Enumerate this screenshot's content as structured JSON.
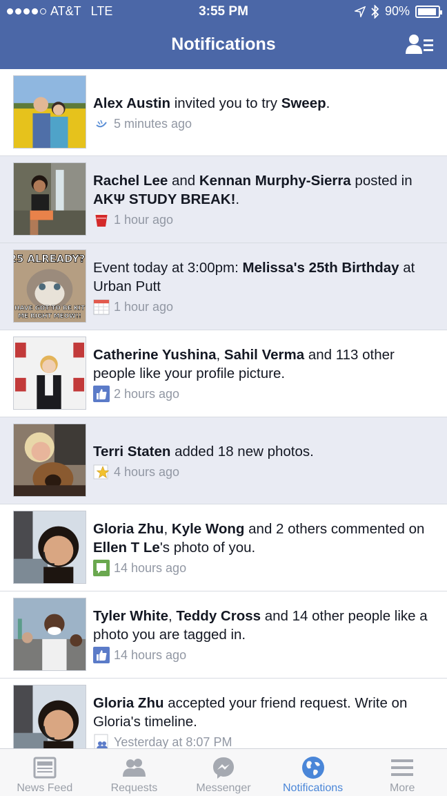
{
  "status_bar": {
    "carrier": "AT&T",
    "network": "LTE",
    "time": "3:55 PM",
    "battery": "90%",
    "signal_bars": 4
  },
  "nav": {
    "title": "Notifications",
    "friend_requests_icon": "friend-list-icon"
  },
  "notifications": [
    {
      "parts": [
        {
          "b": "Alex Austin"
        },
        {
          "t": " invited you to try "
        },
        {
          "b": "Sweep"
        },
        {
          "t": "."
        }
      ],
      "icon": "sweep-app-icon",
      "time": "5 minutes ago",
      "unread": false
    },
    {
      "parts": [
        {
          "b": "Rachel Lee"
        },
        {
          "t": " and "
        },
        {
          "b": "Kennan Murphy-Sierra"
        },
        {
          "t": " posted in "
        },
        {
          "b": "AKΨ STUDY BREAK!"
        },
        {
          "t": "."
        }
      ],
      "icon": "red-cup-icon",
      "time": "1 hour ago",
      "unread": true
    },
    {
      "parts": [
        {
          "t": "Event today at 3:00pm: "
        },
        {
          "b": "Melissa's 25th Birthday"
        },
        {
          "t": " at Urban Putt"
        }
      ],
      "icon": "calendar-icon",
      "time": "1 hour ago",
      "unread": true,
      "thumb_text_top": "25 ALREADY?!",
      "thumb_text_bottom": "HAVE GOT TO BE KIT ME RIGHT MEOW!!"
    },
    {
      "parts": [
        {
          "b": "Catherine Yushina"
        },
        {
          "t": ", "
        },
        {
          "b": "Sahil Verma"
        },
        {
          "t": " and 113 other people like your profile picture."
        }
      ],
      "icon": "like-icon",
      "time": "2 hours ago",
      "unread": false
    },
    {
      "parts": [
        {
          "b": "Terri Staten"
        },
        {
          "t": " added 18 new photos."
        }
      ],
      "icon": "star-photo-icon",
      "time": "4 hours ago",
      "unread": true
    },
    {
      "parts": [
        {
          "b": "Gloria Zhu"
        },
        {
          "t": ", "
        },
        {
          "b": "Kyle Wong"
        },
        {
          "t": " and 2 others commented on "
        },
        {
          "b": "Ellen T Le"
        },
        {
          "t": "'s photo of you."
        }
      ],
      "icon": "comment-icon",
      "time": "14 hours ago",
      "unread": false
    },
    {
      "parts": [
        {
          "b": "Tyler White"
        },
        {
          "t": ", "
        },
        {
          "b": "Teddy Cross"
        },
        {
          "t": " and 14 other people like a photo you are tagged in."
        }
      ],
      "icon": "like-icon",
      "time": "14 hours ago",
      "unread": false
    },
    {
      "parts": [
        {
          "b": "Gloria Zhu"
        },
        {
          "t": " accepted your friend request. Write on Gloria's timeline."
        }
      ],
      "icon": "friend-accepted-icon",
      "time": "Yesterday at 8:07 PM",
      "unread": false
    }
  ],
  "tabs": [
    {
      "label": "News Feed",
      "icon": "news-feed-icon",
      "active": false
    },
    {
      "label": "Requests",
      "icon": "requests-icon",
      "active": false
    },
    {
      "label": "Messenger",
      "icon": "messenger-icon",
      "active": false
    },
    {
      "label": "Notifications",
      "icon": "globe-icon",
      "active": true
    },
    {
      "label": "More",
      "icon": "menu-icon",
      "active": false
    }
  ],
  "colors": {
    "header": "#4b67a7",
    "unread_row": "#e9ebf3",
    "active_tab": "#4a86d8",
    "inactive_tab": "#9a9fa8"
  }
}
